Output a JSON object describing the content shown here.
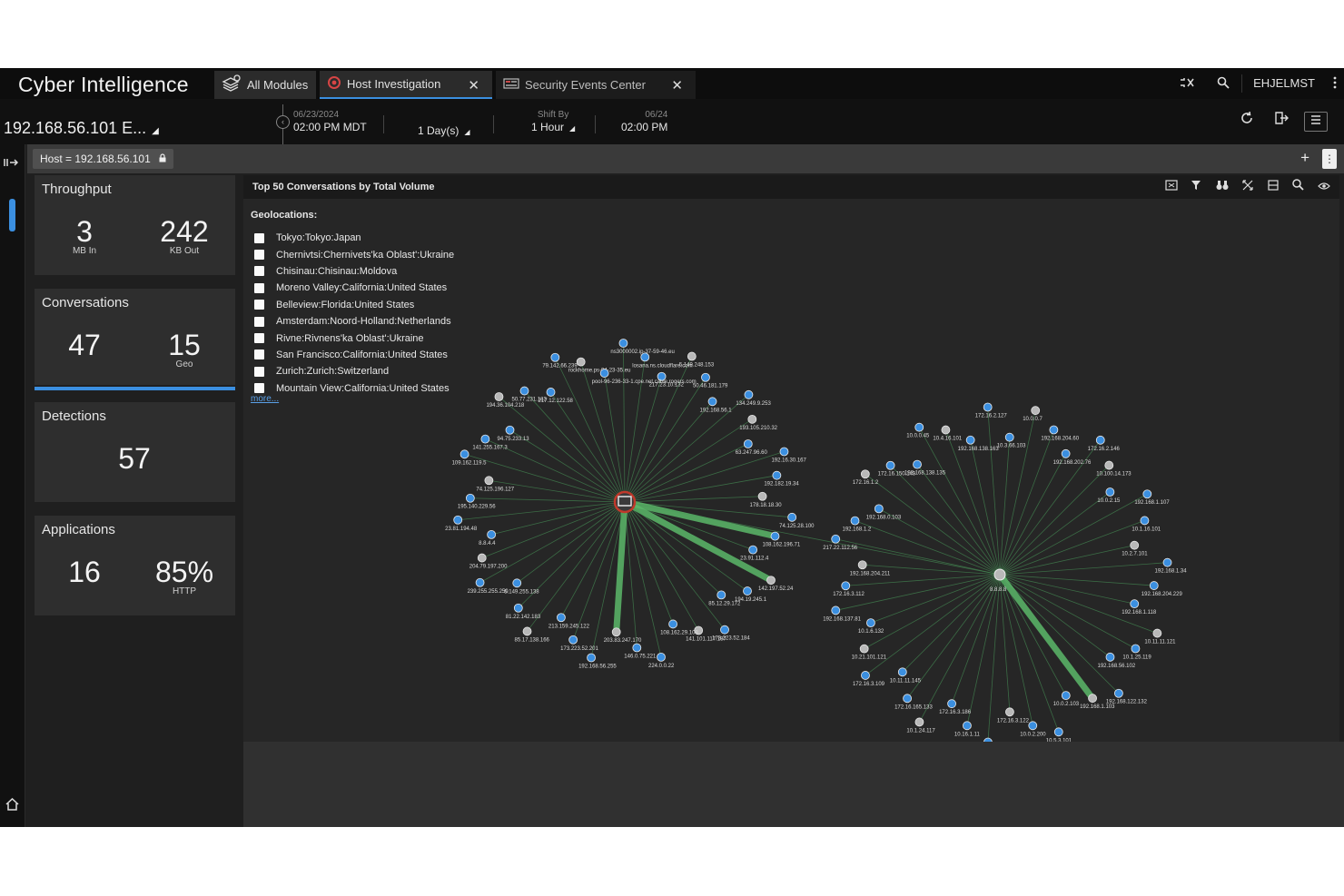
{
  "app": {
    "title": "Cyber Intelligence"
  },
  "tabs": [
    {
      "label": "All Modules",
      "icon": "modules-icon",
      "closable": false
    },
    {
      "label": "Host Investigation",
      "icon": "host-investigation-icon",
      "closable": true,
      "active": true
    },
    {
      "label": "Security Events Center",
      "icon": "security-events-icon",
      "closable": true
    }
  ],
  "topbar": {
    "username": "EHJELMST",
    "close_tab_glyph": "✕"
  },
  "context": {
    "title": "192.168.56.101 E...",
    "time_start_date": "06/23/2024",
    "time_start_time": "02:00 PM MDT",
    "duration": "1 Day(s)",
    "shift_by_label": "Shift By",
    "shift_by_value": "1 Hour",
    "time_end_date": "06/24",
    "time_end_time": "02:00 PM"
  },
  "filter": {
    "chip": "Host = 192.168.56.101"
  },
  "cards": {
    "throughput": {
      "title": "Throughput",
      "a_value": "3",
      "a_label": "MB In",
      "b_value": "242",
      "b_label": "KB Out"
    },
    "conversations": {
      "title": "Conversations",
      "a_value": "47",
      "b_value": "15",
      "b_label": "Geo"
    },
    "detections": {
      "title": "Detections",
      "value": "57"
    },
    "applications": {
      "title": "Applications",
      "a_value": "16",
      "b_value": "85%",
      "b_label": "HTTP"
    }
  },
  "panel": {
    "title": "Top 50 Conversations by Total Volume",
    "geo_title": "Geolocations:",
    "geolocations": [
      "Tokyo:Tokyo:Japan",
      "Chernivtsi:Chernivets'ka Oblast':Ukraine",
      "Chisinau:Chisinau:Moldova",
      "Moreno Valley:California:United States",
      "Belleview:Florida:United States",
      "Amsterdam:Noord-Holland:Netherlands",
      "Rivne:Rivnens'ka Oblast':Ukraine",
      "San Francisco:California:United States",
      "Zurich:Zurich:Switzerland",
      "Mountain View:California:United States"
    ],
    "more": "more..."
  },
  "graph": {
    "colors": {
      "edge": "#4a9a5a",
      "heavy_edge": "#5cb86a",
      "node_blue": "#3b8fe0",
      "node_gray": "#b8b8b8",
      "center_ring": "#c0392b"
    },
    "left_cluster": {
      "center_label": "",
      "nodes": [
        "217.23.10.132",
        "5.149.248.153",
        "50.46.181.179",
        "192.168.56.1",
        "134.249.9.253",
        "193.105.210.32",
        "63.247.96.60",
        "192.16.30.167",
        "192.182.19.34",
        "178.18.18.30",
        "74.125.28.100",
        "108.162.196.71",
        "23.91.112.4",
        "142.197.52.24",
        "194.19.245.1",
        "85.12.29.172",
        "173.223.52.184",
        "141.101.117.187",
        "108.162.29.108",
        "224.0.0.22",
        "146.0.75.221",
        "203.83.247.170",
        "192.168.56.255",
        "173.223.52.201",
        "213.159.245.122",
        "85.17.138.166",
        "81.22.142.183",
        "5.149.255.138",
        "239.255.255.250",
        "204.79.197.200",
        "8.8.4.4",
        "23.81.194.48",
        "195.140.229.56",
        "74.125.196.127",
        "109.162.119.5",
        "141.255.167.3",
        "94.75.233.13",
        "194.36.104.218",
        "50.77.231.183",
        "217.12.122.58",
        "79.142.66.239",
        "rockhome.ps-94-23-35.eu",
        "pool-96-236-33-1.cpe.net.cable.rogers.com",
        "ns3000002.ip-37-59-46.eu",
        "losana.ns.cloudflare.com"
      ]
    },
    "right_cluster": {
      "center_label": "8.8.8.8",
      "nodes": [
        "10.3.66.103",
        "10.0.0.7",
        "192.168.204.60",
        "192.168.202.76",
        "172.16.2.146",
        "10.100.14.173",
        "10.0.2.15",
        "192.168.1.107",
        "10.1.16.101",
        "10.2.7.101",
        "192.168.1.34",
        "192.168.204.229",
        "192.168.1.118",
        "10.11.11.121",
        "10.1.25.119",
        "192.168.56.102",
        "192.168.122.132",
        "192.168.1.103",
        "10.0.2.103",
        "10.5.3.101",
        "10.0.2.200",
        "172.16.3.122",
        "192.168.204.223",
        "10.16.1.11",
        "172.16.3.186",
        "10.1.24.117",
        "172.16.165.133",
        "10.11.11.145",
        "172.16.3.109",
        "10.21.101.121",
        "10.1.6.132",
        "192.168.137.81",
        "172.16.3.112",
        "192.168.204.211",
        "217.22.112.56",
        "192.168.1.2",
        "192.168.0.103",
        "172.16.1.2",
        "172.16.150.149",
        "192.168.138.135",
        "10.0.0.45",
        "10.4.16.101",
        "192.168.138.163",
        "172.16.2.127"
      ]
    }
  }
}
